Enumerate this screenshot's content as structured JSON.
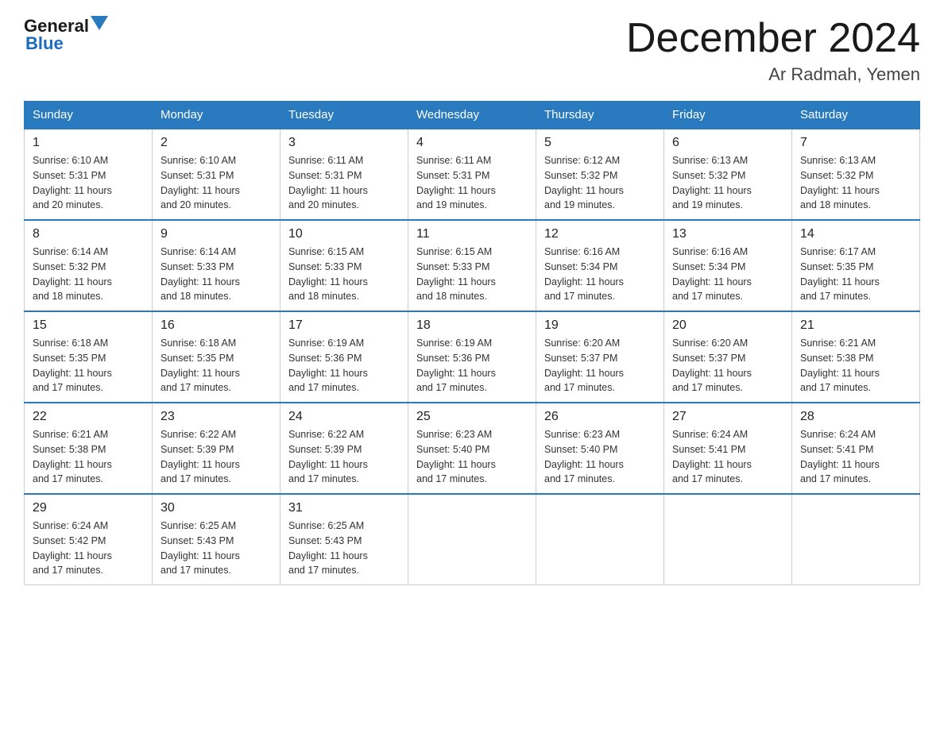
{
  "header": {
    "logo_general": "General",
    "logo_blue": "Blue",
    "month_title": "December 2024",
    "location": "Ar Radmah, Yemen"
  },
  "days_of_week": [
    "Sunday",
    "Monday",
    "Tuesday",
    "Wednesday",
    "Thursday",
    "Friday",
    "Saturday"
  ],
  "weeks": [
    [
      {
        "day": "1",
        "sunrise": "6:10 AM",
        "sunset": "5:31 PM",
        "daylight": "11 hours and 20 minutes."
      },
      {
        "day": "2",
        "sunrise": "6:10 AM",
        "sunset": "5:31 PM",
        "daylight": "11 hours and 20 minutes."
      },
      {
        "day": "3",
        "sunrise": "6:11 AM",
        "sunset": "5:31 PM",
        "daylight": "11 hours and 20 minutes."
      },
      {
        "day": "4",
        "sunrise": "6:11 AM",
        "sunset": "5:31 PM",
        "daylight": "11 hours and 19 minutes."
      },
      {
        "day": "5",
        "sunrise": "6:12 AM",
        "sunset": "5:32 PM",
        "daylight": "11 hours and 19 minutes."
      },
      {
        "day": "6",
        "sunrise": "6:13 AM",
        "sunset": "5:32 PM",
        "daylight": "11 hours and 19 minutes."
      },
      {
        "day": "7",
        "sunrise": "6:13 AM",
        "sunset": "5:32 PM",
        "daylight": "11 hours and 18 minutes."
      }
    ],
    [
      {
        "day": "8",
        "sunrise": "6:14 AM",
        "sunset": "5:32 PM",
        "daylight": "11 hours and 18 minutes."
      },
      {
        "day": "9",
        "sunrise": "6:14 AM",
        "sunset": "5:33 PM",
        "daylight": "11 hours and 18 minutes."
      },
      {
        "day": "10",
        "sunrise": "6:15 AM",
        "sunset": "5:33 PM",
        "daylight": "11 hours and 18 minutes."
      },
      {
        "day": "11",
        "sunrise": "6:15 AM",
        "sunset": "5:33 PM",
        "daylight": "11 hours and 18 minutes."
      },
      {
        "day": "12",
        "sunrise": "6:16 AM",
        "sunset": "5:34 PM",
        "daylight": "11 hours and 17 minutes."
      },
      {
        "day": "13",
        "sunrise": "6:16 AM",
        "sunset": "5:34 PM",
        "daylight": "11 hours and 17 minutes."
      },
      {
        "day": "14",
        "sunrise": "6:17 AM",
        "sunset": "5:35 PM",
        "daylight": "11 hours and 17 minutes."
      }
    ],
    [
      {
        "day": "15",
        "sunrise": "6:18 AM",
        "sunset": "5:35 PM",
        "daylight": "11 hours and 17 minutes."
      },
      {
        "day": "16",
        "sunrise": "6:18 AM",
        "sunset": "5:35 PM",
        "daylight": "11 hours and 17 minutes."
      },
      {
        "day": "17",
        "sunrise": "6:19 AM",
        "sunset": "5:36 PM",
        "daylight": "11 hours and 17 minutes."
      },
      {
        "day": "18",
        "sunrise": "6:19 AM",
        "sunset": "5:36 PM",
        "daylight": "11 hours and 17 minutes."
      },
      {
        "day": "19",
        "sunrise": "6:20 AM",
        "sunset": "5:37 PM",
        "daylight": "11 hours and 17 minutes."
      },
      {
        "day": "20",
        "sunrise": "6:20 AM",
        "sunset": "5:37 PM",
        "daylight": "11 hours and 17 minutes."
      },
      {
        "day": "21",
        "sunrise": "6:21 AM",
        "sunset": "5:38 PM",
        "daylight": "11 hours and 17 minutes."
      }
    ],
    [
      {
        "day": "22",
        "sunrise": "6:21 AM",
        "sunset": "5:38 PM",
        "daylight": "11 hours and 17 minutes."
      },
      {
        "day": "23",
        "sunrise": "6:22 AM",
        "sunset": "5:39 PM",
        "daylight": "11 hours and 17 minutes."
      },
      {
        "day": "24",
        "sunrise": "6:22 AM",
        "sunset": "5:39 PM",
        "daylight": "11 hours and 17 minutes."
      },
      {
        "day": "25",
        "sunrise": "6:23 AM",
        "sunset": "5:40 PM",
        "daylight": "11 hours and 17 minutes."
      },
      {
        "day": "26",
        "sunrise": "6:23 AM",
        "sunset": "5:40 PM",
        "daylight": "11 hours and 17 minutes."
      },
      {
        "day": "27",
        "sunrise": "6:24 AM",
        "sunset": "5:41 PM",
        "daylight": "11 hours and 17 minutes."
      },
      {
        "day": "28",
        "sunrise": "6:24 AM",
        "sunset": "5:41 PM",
        "daylight": "11 hours and 17 minutes."
      }
    ],
    [
      {
        "day": "29",
        "sunrise": "6:24 AM",
        "sunset": "5:42 PM",
        "daylight": "11 hours and 17 minutes."
      },
      {
        "day": "30",
        "sunrise": "6:25 AM",
        "sunset": "5:43 PM",
        "daylight": "11 hours and 17 minutes."
      },
      {
        "day": "31",
        "sunrise": "6:25 AM",
        "sunset": "5:43 PM",
        "daylight": "11 hours and 17 minutes."
      },
      null,
      null,
      null,
      null
    ]
  ],
  "labels": {
    "sunrise": "Sunrise:",
    "sunset": "Sunset:",
    "daylight": "Daylight:"
  }
}
